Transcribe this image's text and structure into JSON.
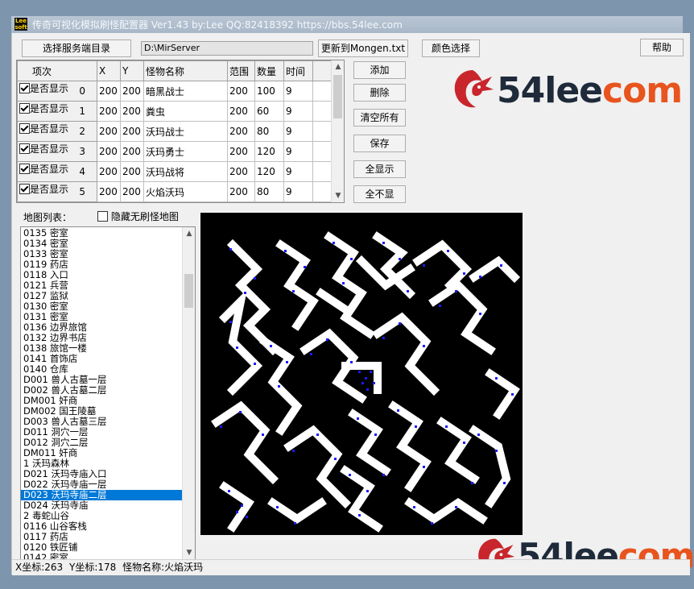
{
  "window": {
    "logo": "Lee soft",
    "title": "传奇可视化模拟刷怪配置器   Ver1.43   by:Lee   QQ:82418392   https://bbs.54lee.com"
  },
  "toolbar": {
    "select_server_dir": "选择服务端目录",
    "server_path": "D:\\MirServer",
    "update_mongen": "更新到Mongen.txt",
    "color_select": "颜色选择",
    "help": "帮助"
  },
  "grid": {
    "headers": [
      "项次",
      "X",
      "Y",
      "怪物名称",
      "范围",
      "数量",
      "时间"
    ],
    "row_check_label": "是否显示",
    "rows": [
      {
        "idx": "0",
        "x": "200",
        "y": "200",
        "name": "暗黑战士",
        "range": "200",
        "count": "100",
        "time": "9"
      },
      {
        "idx": "1",
        "x": "200",
        "y": "200",
        "name": "粪虫",
        "range": "200",
        "count": "60",
        "time": "9"
      },
      {
        "idx": "2",
        "x": "200",
        "y": "200",
        "name": "沃玛战士",
        "range": "200",
        "count": "80",
        "time": "9"
      },
      {
        "idx": "3",
        "x": "200",
        "y": "200",
        "name": "沃玛勇士",
        "range": "200",
        "count": "120",
        "time": "9"
      },
      {
        "idx": "4",
        "x": "200",
        "y": "200",
        "name": "沃玛战将",
        "range": "200",
        "count": "120",
        "time": "9"
      },
      {
        "idx": "5",
        "x": "200",
        "y": "200",
        "name": "火焰沃玛",
        "range": "200",
        "count": "80",
        "time": "9"
      }
    ]
  },
  "actions": {
    "add": "添加",
    "delete": "删除",
    "clear_all": "清空所有",
    "save": "保存",
    "show_all": "全显示",
    "hide_all": "全不显"
  },
  "brand": {
    "part1": "54lee",
    "part2": "com"
  },
  "map_list": {
    "label": "地图列表：",
    "hide_no_monster": "隐藏无刷怪地图",
    "selected_index": 25,
    "items": [
      "0135 密室",
      "0134 密室",
      "0133 密室",
      "0119 药店",
      "0118 入口",
      "0121 兵营",
      "0127 监狱",
      "0130 密室",
      "0131 密室",
      "0136 边界旅馆",
      "0132 边界书店",
      "0138 旅馆一楼",
      "0141 首饰店",
      "0140 仓库",
      "D001 兽人古墓一层",
      "D002 兽人古墓二层",
      "DM001 奸商",
      "DM002 国王陵墓",
      "D003 兽人古墓三层",
      "D011 洞穴一层",
      "D012 洞穴二层",
      "DM011 奸商",
      "1 沃玛森林",
      "D021 沃玛寺庙入口",
      "D022 沃玛寺庙一层",
      "D023 沃玛寺庙二层",
      "D024 沃玛寺庙",
      "2 毒蛇山谷",
      "0116 山谷客栈",
      "0117 药店",
      "0120 铁匠铺",
      "0142 密室"
    ]
  },
  "status": {
    "x_label": "X坐标:",
    "x": "263",
    "y_label": "Y坐标:",
    "y": "178",
    "monster_label": "怪物名称:",
    "monster": "火焰沃玛"
  },
  "colors": {
    "accent": "#0078d7",
    "brand_dark": "#1f2a3a",
    "brand_orange": "#e8541e",
    "dragon": "#c8262c",
    "monster_dot": "#1a1aff"
  }
}
